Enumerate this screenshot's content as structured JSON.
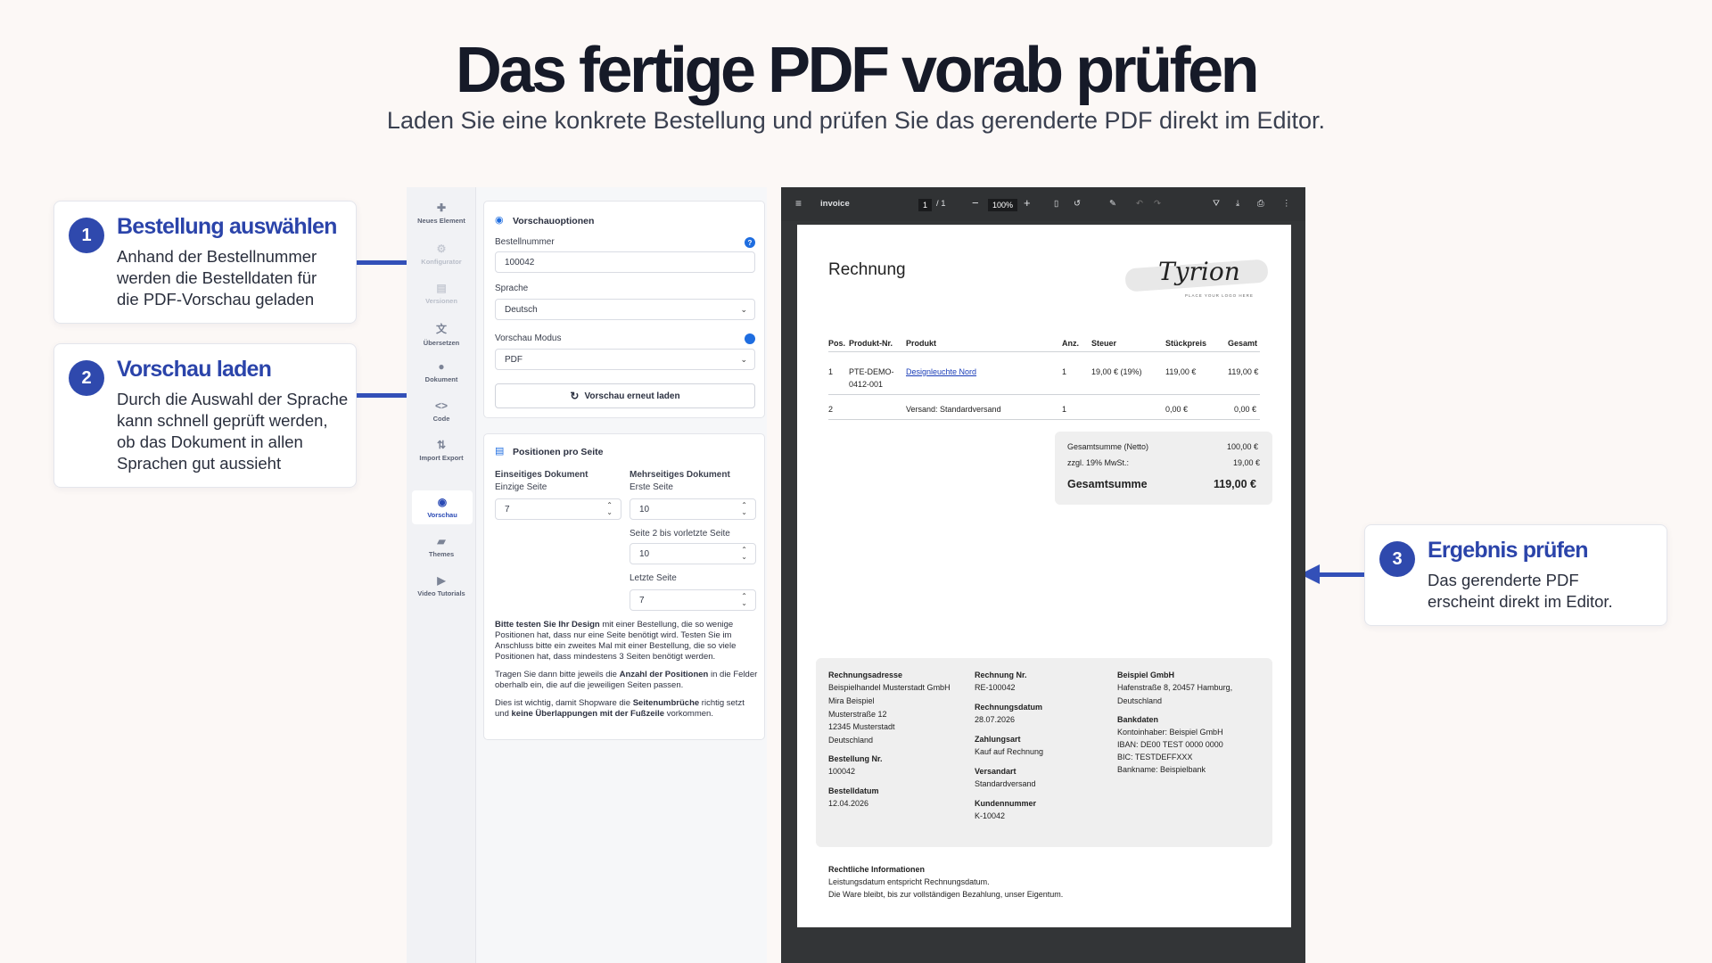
{
  "hero": {
    "title": "Das fertige PDF vorab prüfen",
    "subtitle": "Laden Sie eine konkrete Bestellung und prüfen Sie das gerenderte PDF direkt im Editor."
  },
  "steps": [
    {
      "num": "1",
      "title": "Bestellung auswählen",
      "body": "Anhand der Bestellnummer werden die Bestelldaten für die PDF-Vorschau geladen"
    },
    {
      "num": "2",
      "title": "Vorschau laden",
      "body": "Durch die Auswahl der Sprache kann schnell geprüft werden, ob das Dokument in allen Sprachen gut aussieht"
    },
    {
      "num": "3",
      "title": "Ergebnis prüfen",
      "body": "Das gerenderte PDF erscheint direkt im Editor."
    }
  ],
  "sidebar": [
    {
      "icon": "puzzle-icon",
      "label": "Neues Element"
    },
    {
      "icon": "gear-icon",
      "label": "Konfigurator"
    },
    {
      "icon": "versions-icon",
      "label": "Versionen"
    },
    {
      "icon": "translate-icon",
      "label": "Übersetzen"
    },
    {
      "icon": "palette-icon",
      "label": "Dokument"
    },
    {
      "icon": "code-icon",
      "label": "Code"
    },
    {
      "icon": "import-export-icon",
      "label": "Import Export"
    },
    {
      "icon": "eye-icon",
      "label": "Vorschau"
    },
    {
      "icon": "themes-icon",
      "label": "Themes"
    },
    {
      "icon": "video-icon",
      "label": "Video Tutorials"
    }
  ],
  "preview_options": {
    "title": "Vorschauoptionen",
    "order_label": "Bestellnummer",
    "order_value": "100042",
    "language_label": "Sprache",
    "language_value": "Deutsch",
    "mode_label": "Vorschau Modus",
    "mode_value": "PDF",
    "reload_button": "Vorschau erneut laden"
  },
  "positions": {
    "title": "Positionen pro Seite",
    "single_title": "Einseitiges Dokument",
    "single_label": "Einzige Seite",
    "single_value": "7",
    "multi_title": "Mehrseitiges Dokument",
    "first_label": "Erste Seite",
    "first_value": "10",
    "middle_label": "Seite 2 bis vorletzte Seite",
    "middle_value": "10",
    "last_label": "Letzte Seite",
    "last_value": "7",
    "help1_bold": "Bitte testen Sie Ihr Design",
    "help1_rest": " mit einer Bestellung, die so wenige Positionen hat, dass nur eine Seite benötigt wird. Testen Sie im Anschluss bitte ein zweites Mal mit einer Bestellung, die so viele Positionen hat, dass mindestens 3 Seiten benötigt werden.",
    "help2_a": "Tragen Sie dann bitte jeweils die ",
    "help2_bold": "Anzahl der Positionen",
    "help2_b": " in die Felder oberhalb ein, die auf die jeweiligen Seiten passen.",
    "help3_a": "Dies ist wichtig, damit Shopware die ",
    "help3_bold1": "Seitenumbrüche",
    "help3_b": " richtig setzt und ",
    "help3_bold2": "keine Überlappungen mit der Fußzeile",
    "help3_c": " vorkommen."
  },
  "viewer": {
    "doc_name": "invoice",
    "page_current": "1",
    "page_total": "/ 1",
    "zoom": "100%"
  },
  "invoice": {
    "title": "Rechnung",
    "logo_text": "Tyrion",
    "logo_tag": "PLACE YOUR LOGO HERE",
    "columns": [
      "Pos.",
      "Produkt-Nr.",
      "Produkt",
      "Anz.",
      "Steuer",
      "Stückpreis",
      "Gesamt"
    ],
    "rows": [
      {
        "pos": "1",
        "nr1": "PTE-DEMO-",
        "nr2": "0412-001",
        "product": "Designleuchte Nord",
        "qty": "1",
        "tax": "19,00 € (19%)",
        "price": "119,00 €",
        "total": "119,00 €"
      },
      {
        "pos": "2",
        "nr1": "",
        "nr2": "",
        "product": "Versand: Standardversand",
        "qty": "1",
        "tax": "",
        "price": "0,00 €",
        "total": "0,00 €"
      }
    ],
    "sum_net_label": "Gesamtsumme (Netto)",
    "sum_net": "100,00 €",
    "vat_label": "zzgl. 19% MwSt.:",
    "vat": "19,00 €",
    "total_label": "Gesamtsumme",
    "total": "119,00 €",
    "address_title": "Rechnungsadresse",
    "address_lines": [
      "Beispielhandel Musterstadt GmbH",
      "Mira Beispiel",
      "Musterstraße 12",
      "12345 Musterstadt",
      "Deutschland"
    ],
    "order_no_label": "Bestellung Nr.",
    "order_no": "100042",
    "order_date_label": "Bestelldatum",
    "order_date": "12.04.2026",
    "invoice_no_label": "Rechnung Nr.",
    "invoice_no": "RE-100042",
    "invoice_date_label": "Rechnungsdatum",
    "invoice_date": "28.07.2026",
    "payment_label": "Zahlungsart",
    "payment": "Kauf auf Rechnung",
    "shipping_label": "Versandart",
    "shipping": "Standardversand",
    "customer_label": "Kundennummer",
    "customer": "K-10042",
    "company": "Beispiel GmbH",
    "company_addr1": "Hafenstraße 8, 20457 Hamburg,",
    "company_addr2": "Deutschland",
    "bank_title": "Bankdaten",
    "bank_lines": [
      "Kontoinhaber: Beispiel GmbH",
      "IBAN: DE00 TEST 0000 0000",
      "BIC: TESTDEFFXXX",
      "Bankname: Beispielbank"
    ],
    "legal_title": "Rechtliche Informationen",
    "legal1": "Leistungsdatum entspricht Rechnungsdatum.",
    "legal2": "Die Ware bleibt, bis zur vollständigen Bezahlung, unser Eigentum."
  }
}
